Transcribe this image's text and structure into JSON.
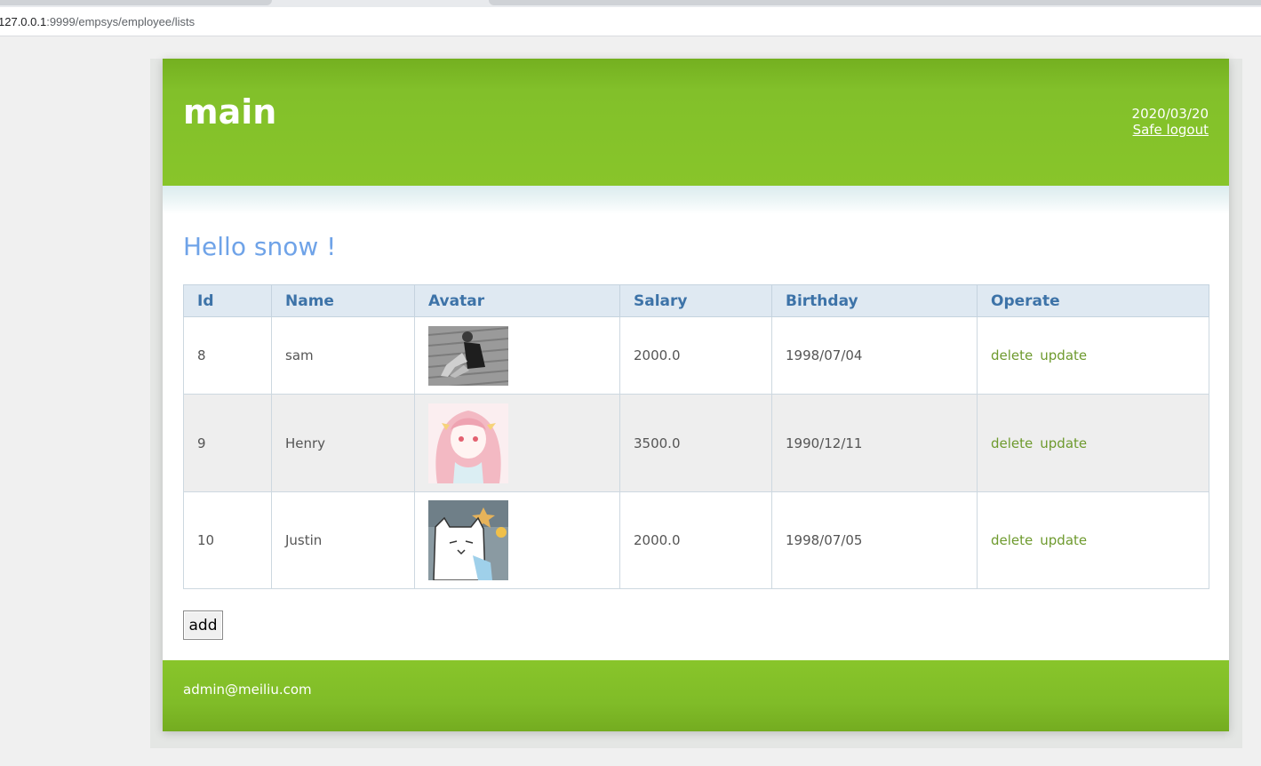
{
  "browser": {
    "url_host": "127.0.0.1",
    "url_path": ":9999/empsys/employee/lists"
  },
  "header": {
    "title": "main",
    "date": "2020/03/20",
    "logout_label": "Safe logout"
  },
  "greeting": "Hello snow !",
  "table": {
    "columns": [
      "Id",
      "Name",
      "Avatar",
      "Salary",
      "Birthday",
      "Operate"
    ],
    "rows": [
      {
        "id": "8",
        "name": "sam",
        "avatar": "grayscale-photo-person-sitting",
        "salary": "2000.0",
        "birthday": "1998/07/04",
        "delete_label": "delete",
        "update_label": "update"
      },
      {
        "id": "9",
        "name": "Henry",
        "avatar": "anime-girl-pink-hair",
        "salary": "3500.0",
        "birthday": "1990/12/11",
        "delete_label": "delete",
        "update_label": "update"
      },
      {
        "id": "10",
        "name": "Justin",
        "avatar": "cartoon-white-cat",
        "salary": "2000.0",
        "birthday": "1998/07/05",
        "delete_label": "delete",
        "update_label": "update"
      }
    ]
  },
  "add_label": "add",
  "footer": {
    "email": "admin@meiliu.com"
  },
  "colors": {
    "header_green": "#88c52a",
    "greeting_blue": "#6fa3e8",
    "link_green": "#6e9a2e",
    "table_header_bg": "#dfe9f2",
    "table_header_text": "#3d73a8"
  }
}
